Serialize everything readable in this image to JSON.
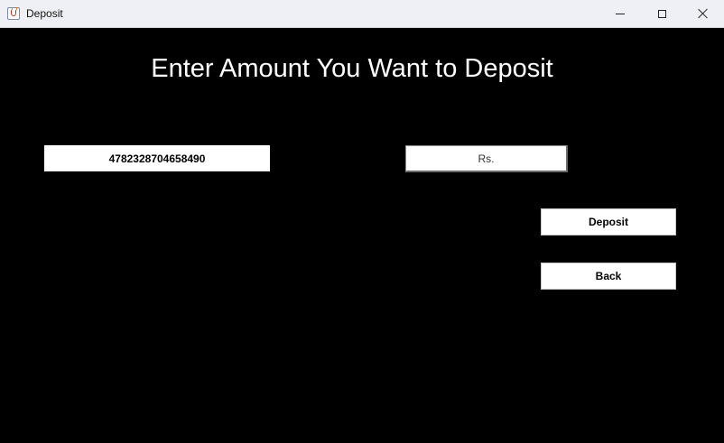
{
  "window": {
    "title": "Deposit",
    "icon": "java-cup-icon",
    "controls": [
      "minimize-icon",
      "maximize-icon",
      "close-icon"
    ]
  },
  "main": {
    "heading": "Enter Amount You Want to Deposit",
    "card_number": "4782328704658490",
    "amount_placeholder": "Rs.",
    "amount_value": "",
    "deposit_label": "Deposit",
    "back_label": "Back"
  },
  "colors": {
    "background": "#000000",
    "text_on_background": "#ffffff",
    "field_background": "#ffffff"
  }
}
